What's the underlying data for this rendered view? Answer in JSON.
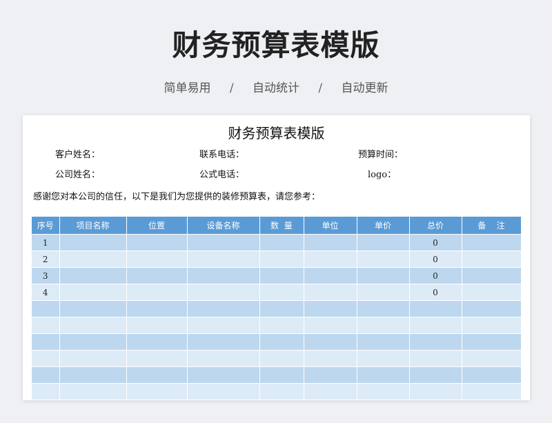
{
  "hero": {
    "title": "财务预算表模版",
    "tags": [
      "简单易用",
      "自动统计",
      "自动更新"
    ],
    "separator": "/"
  },
  "sheet": {
    "title": "财务预算表模版",
    "fields": {
      "customer_name": "客户姓名：",
      "contact_phone": "联系电话：",
      "budget_time": "预算时间：",
      "company_name": "公司姓名：",
      "company_phone": "公式电话：",
      "logo": "logo："
    },
    "thanks": "感谢您对本公司的信任，以下是我们为您提供的装修预算表，请您参考：",
    "columns": [
      "序号",
      "项目名称",
      "位置",
      "设备名称",
      "数  量",
      "单位",
      "单价",
      "总价",
      "备    注"
    ],
    "rows": [
      [
        "1",
        "",
        "",
        "",
        "",
        "",
        "",
        "0",
        ""
      ],
      [
        "2",
        "",
        "",
        "",
        "",
        "",
        "",
        "0",
        ""
      ],
      [
        "3",
        "",
        "",
        "",
        "",
        "",
        "",
        "0",
        ""
      ],
      [
        "4",
        "",
        "",
        "",
        "",
        "",
        "",
        "0",
        ""
      ],
      [
        "",
        "",
        "",
        "",
        "",
        "",
        "",
        "",
        ""
      ],
      [
        "",
        "",
        "",
        "",
        "",
        "",
        "",
        "",
        ""
      ],
      [
        "",
        "",
        "",
        "",
        "",
        "",
        "",
        "",
        ""
      ],
      [
        "",
        "",
        "",
        "",
        "",
        "",
        "",
        "",
        ""
      ],
      [
        "",
        "",
        "",
        "",
        "",
        "",
        "",
        "",
        ""
      ],
      [
        "",
        "",
        "",
        "",
        "",
        "",
        "",
        "",
        ""
      ]
    ]
  }
}
